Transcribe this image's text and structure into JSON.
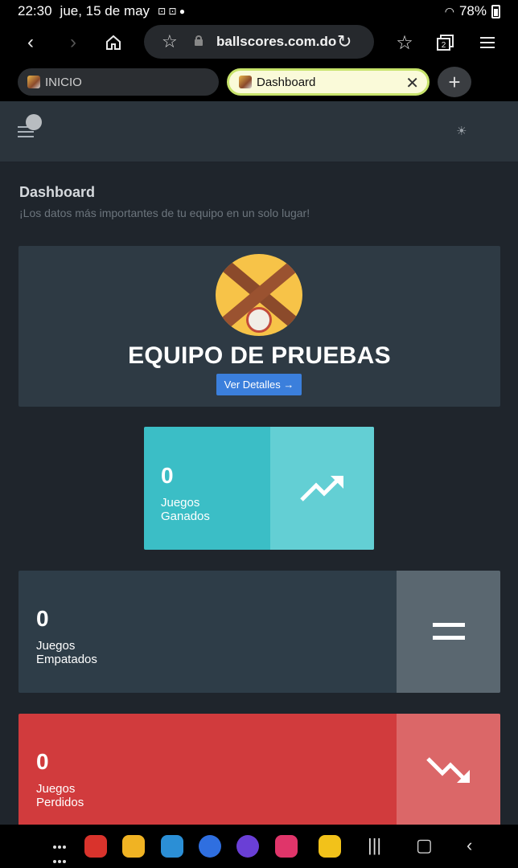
{
  "statusbar": {
    "time": "22:30",
    "date": "jue, 15 de may",
    "battery": "78%"
  },
  "browser": {
    "url": "ballscores.com.do",
    "tabs": [
      {
        "label": "INICIO",
        "active": false
      },
      {
        "label": "Dashboard",
        "active": true
      }
    ],
    "tab_count": "2"
  },
  "page": {
    "title": "Dashboard",
    "subtitle": "¡Los datos más importantes de tu equipo en un solo lugar!"
  },
  "team": {
    "name": "EQUIPO DE PRUEBAS",
    "details_button": "Ver Detalles →"
  },
  "stats": {
    "won": {
      "value": "0",
      "label": "Juegos Ganados",
      "color": "#3bbec6"
    },
    "tied": {
      "value": "0",
      "label": "Juegos Empatados",
      "color": "#2e3d48"
    },
    "lost": {
      "value": "0",
      "label": "Juegos Perdidos",
      "color": "#d13b3d"
    }
  },
  "icons": {
    "won": "trending-up-icon",
    "tied": "equals-icon",
    "lost": "trending-down-icon"
  }
}
